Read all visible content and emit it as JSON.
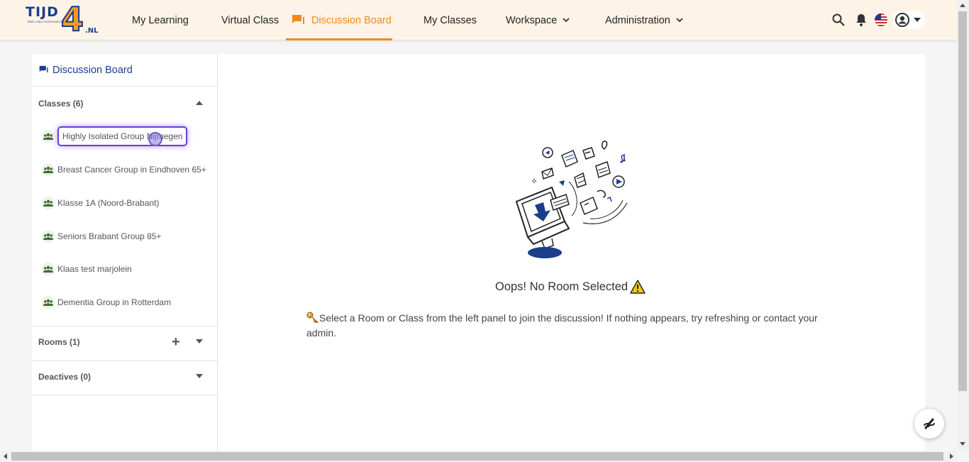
{
  "logo": {
    "main": "TIJD",
    "digit": "4",
    "suffix": ".NL",
    "tagline": "TIME 4 SELF INTEGRATION"
  },
  "nav": {
    "items": [
      {
        "label": "My Learning"
      },
      {
        "label": "Virtual Class"
      },
      {
        "label": "Discussion Board",
        "active": true,
        "icon": "forum-icon"
      },
      {
        "label": "My Classes"
      },
      {
        "label": "Workspace",
        "dropdown": true
      },
      {
        "label": "Administration",
        "dropdown": true
      }
    ]
  },
  "header_icons": [
    "search-icon",
    "bell-icon",
    "us-flag-icon",
    "account-icon"
  ],
  "sidebar": {
    "title": "Discussion Board",
    "classes": {
      "label": "Classes (6)",
      "items": [
        {
          "label": "Highly Isolated Group Nijmegen",
          "selected": true
        },
        {
          "label": "Breast Cancer Group in Eindhoven 65+"
        },
        {
          "label": "Klasse 1A (Noord-Brabant)"
        },
        {
          "label": "Seniors Brabant Group 85+"
        },
        {
          "label": "Klaas test marjolein"
        },
        {
          "label": "Dementia Group in Rotterdam"
        }
      ]
    },
    "rooms": {
      "label": "Rooms (1)"
    },
    "deactives": {
      "label": "Deactives (0)"
    }
  },
  "main": {
    "empty_title": "Oops! No Room Selected",
    "empty_message": "Select a Room or Class from the left panel to join the discussion! If nothing appears, try refreshing or contact your admin."
  },
  "colors": {
    "accent": "#ef8a1f",
    "brand": "#1c3d8c",
    "topbar": "#fdf3e7",
    "selection": "#6b3fd6"
  }
}
